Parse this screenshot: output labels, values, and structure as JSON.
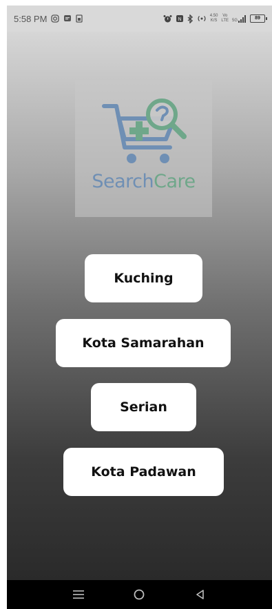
{
  "status_bar": {
    "time": "5:58 PM",
    "speed_value": "4.50",
    "speed_unit": "K/S",
    "net_top": "Vo",
    "net_bottom": "LTE",
    "signal_label": "5G",
    "battery": "89"
  },
  "logo": {
    "text_part1": "Search",
    "text_part2": "Care",
    "colors": {
      "blue": "#6f8fb4",
      "green": "#6fa78a"
    }
  },
  "buttons": {
    "kuching": "Kuching",
    "kota_samarahan": "Kota Samarahan",
    "serian": "Serian",
    "kota_padawan": "Kota Padawan"
  },
  "nav": {
    "menu_icon": "menu-icon",
    "home_icon": "home-circle-icon",
    "back_icon": "back-triangle-icon"
  }
}
